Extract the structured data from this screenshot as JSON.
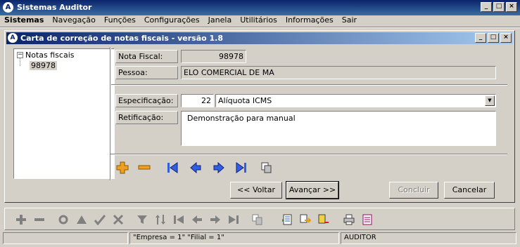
{
  "app": {
    "title": "Sistemas Auditor",
    "icon": "auditor-logo-icon"
  },
  "menu": [
    "Sistemas",
    "Navegação",
    "Funções",
    "Configurações",
    "Janela",
    "Utilitários",
    "Informações",
    "Sair"
  ],
  "child_window": {
    "title": "Carta de correção de notas fiscais - versão 1.8"
  },
  "tree": {
    "root": "Notas fiscais",
    "child": "98978",
    "expander": "⊟"
  },
  "form": {
    "nota_fiscal_label": "Nota Fiscal:",
    "nota_fiscal_value": "98978",
    "pessoa_label": "Pessoa:",
    "pessoa_value": "ELO COMERCIAL DE MA",
    "especificacao_label": "Especificação:",
    "especificacao_code": "22",
    "especificacao_value": "Alíquota ICMS",
    "retificacao_label": "Retificação:",
    "retificacao_value": "Demonstração para manual"
  },
  "buttons": {
    "voltar": "<< Voltar",
    "avancar": "Avançar >>",
    "concluir": "Concluir",
    "cancelar": "Cancelar"
  },
  "status": {
    "empresa": "\"Empresa = 1\"   \"Filial = 1\"",
    "user": "AUDITOR"
  },
  "colors": {
    "title_bar": "#0a246a",
    "accent_orange": "#f0a020",
    "nav_blue": "#3060e0"
  }
}
